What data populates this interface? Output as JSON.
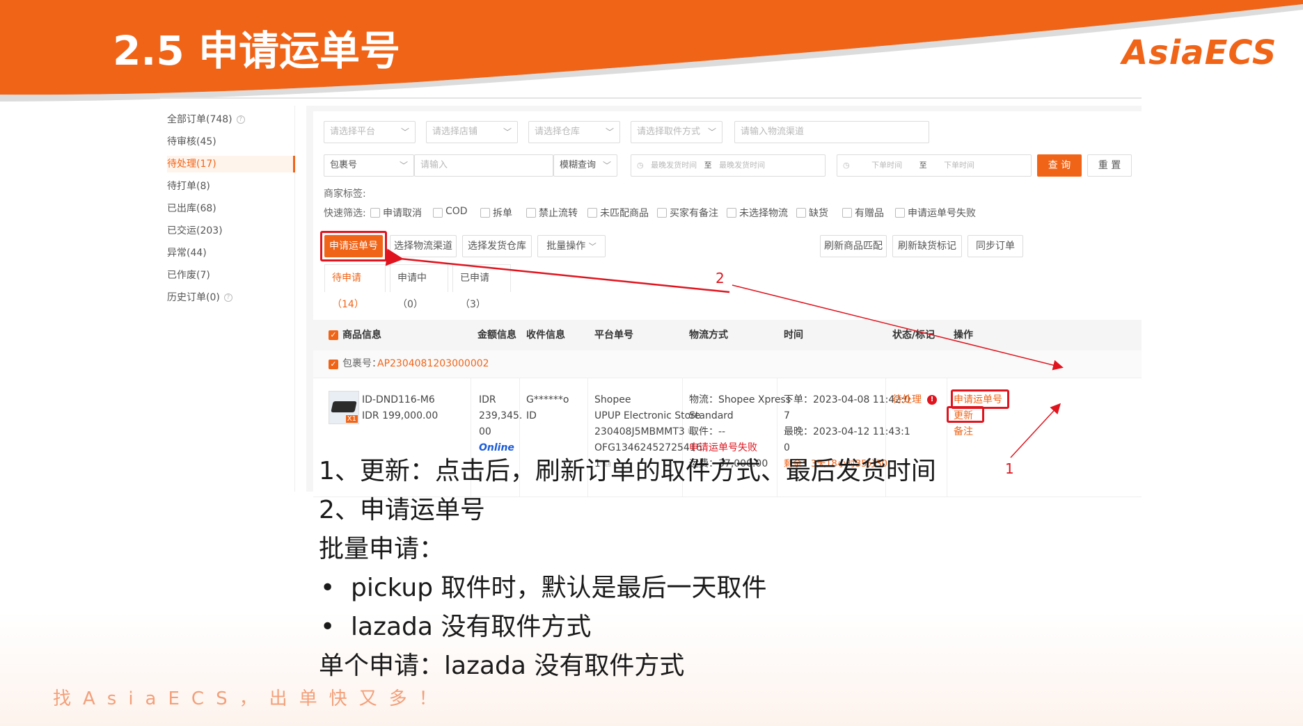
{
  "slide": {
    "title": "2.5 申请运单号",
    "logo": "AsiaECS",
    "slogan": "找AsiaECS，出单快又多！",
    "colors": {
      "brand": "#f06418",
      "annotation": "#e0141e"
    }
  },
  "sidebar": {
    "items": [
      {
        "label": "全部订单(748)",
        "help": true
      },
      {
        "label": "待审核(45)"
      },
      {
        "label": "待处理(17)",
        "active": true
      },
      {
        "label": "待打单(8)"
      },
      {
        "label": "已出库(68)"
      },
      {
        "label": "已交运(203)"
      },
      {
        "label": "异常(44)"
      },
      {
        "label": "已作废(7)"
      },
      {
        "label": "历史订单(0)",
        "help": true
      }
    ]
  },
  "filters": {
    "platform_placeholder": "请选择平台",
    "shop_placeholder": "请选择店铺",
    "warehouse_placeholder": "请选择仓库",
    "pickup_placeholder": "请选择取件方式",
    "channel_placeholder": "请输入物流渠道",
    "package_select": "包裹号",
    "input_placeholder": "请输入",
    "match_select": "模糊查询",
    "ship_time_start": "最晚发货时间",
    "ship_time_sep": "至",
    "ship_time_end": "最晚发货时间",
    "order_time_start": "下单时间",
    "order_time_sep": "至",
    "order_time_end": "下单时间",
    "query_button": "查 询",
    "reset_button": "重 置",
    "merchant_tag_label": "商家标签:",
    "quick_filter_label": "快速筛选:",
    "quick_filters": [
      "申请取消",
      "COD",
      "拆单",
      "禁止流转",
      "未匹配商品",
      "买家有备注",
      "未选择物流",
      "缺货",
      "有赠品",
      "申请运单号失败"
    ]
  },
  "actions": {
    "apply_waybill": "申请运单号",
    "select_channel": "选择物流渠道",
    "select_warehouse": "选择发货仓库",
    "batch": "批量操作",
    "refresh_match": "刷新商品匹配",
    "refresh_stock": "刷新缺货标记",
    "sync_orders": "同步订单"
  },
  "tabs": [
    {
      "label": "待申请（14）",
      "active": true
    },
    {
      "label": "申请中（0）"
    },
    {
      "label": "已申请（3）"
    }
  ],
  "table": {
    "headers": [
      "商品信息",
      "金额信息",
      "收件信息",
      "平台单号",
      "物流方式",
      "时间",
      "状态/标记",
      "操作"
    ],
    "package_label": "包裹号：",
    "package_no": "AP2304081203000002",
    "row": {
      "sku": "ID-DND116-M6",
      "unit_price": "IDR 199,000.00",
      "qty_badge": "X1",
      "amount_lines": [
        "IDR",
        "239,345.",
        "00"
      ],
      "payment": "Online",
      "receiver_lines": [
        "G******o",
        "ID"
      ],
      "platform_lines": [
        "Shopee",
        "UPUP Electronic Store",
        "230408J5MBMMT3",
        "OFG13462452725416",
        "1"
      ],
      "logistics_lines": [
        "物流：Shopee Xpress",
        "Standard",
        "取件：--"
      ],
      "logistics_error": "申请运单号失败",
      "freight": "运费：37,000.00",
      "time_lines": [
        "下单：2023-04-08 11:42:0",
        "7",
        "最晚：2023-04-12 11:43:1",
        "0"
      ],
      "remaining": "剩余：3天18小时35分30",
      "status": "待处理",
      "op_apply": "申请运单号",
      "op_refresh": "更新",
      "op_note": "备注"
    }
  },
  "annotations": {
    "arrow1_label": "1",
    "arrow2_label": "2"
  },
  "notes": {
    "line1": "1、更新：点击后，刷新订单的取件方式、最后发货时间",
    "line2": "2、申请运单号",
    "line3": "批量申请：",
    "bullet1": "pickup 取件时，默认是最后一天取件",
    "bullet2": "lazada 没有取件方式",
    "line4": "单个申请：lazada 没有取件方式"
  }
}
